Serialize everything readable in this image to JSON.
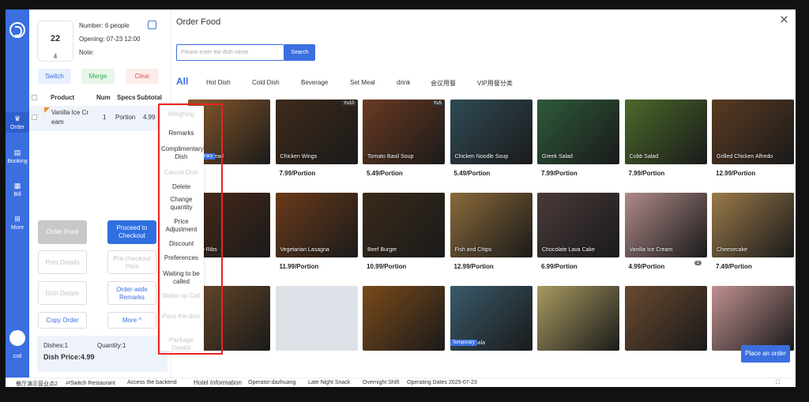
{
  "nav": {
    "items": [
      "Order",
      "Booking",
      "Bill",
      "More"
    ],
    "user": "cstl"
  },
  "table": {
    "number": "22",
    "guests": "4",
    "number_label": "Number: 6 people",
    "opening": "Opening: 07-23 12:00",
    "note": "Note:"
  },
  "actions": {
    "switch": "Switch",
    "merge": "Merge",
    "clear": "Clear"
  },
  "order_table": {
    "headers": [
      "Product",
      "Num",
      "Specs",
      "Subtotal"
    ],
    "rows": [
      {
        "name_line1": "Vanilla Ice Cr",
        "name_line2": "eam",
        "num": "1",
        "spec": "Portion",
        "subtotal": "4.99"
      }
    ]
  },
  "bottom_buttons": {
    "order_food": "Order Food",
    "proceed_1": "Proceed to",
    "proceed_2": "Checkout",
    "print_details": "Print Details",
    "precheckout_1": "Pre-checkout",
    "precheckout_2": "Print",
    "dish_details": "Dish Details",
    "orderwide_1": "Order-wide",
    "orderwide_2": "Remarks",
    "copy_order": "Copy Order",
    "more": "More ^"
  },
  "summary": {
    "dishes": "Dishes:1",
    "quantity": "Quantity:1",
    "price": "Dish Price:4.99"
  },
  "context_menu": {
    "items": [
      {
        "label": "Weighing",
        "enabled": false
      },
      {
        "label": "Remarks",
        "enabled": true
      },
      {
        "label": "Complimentary Dish",
        "enabled": true
      },
      {
        "label": "Cancel Dish",
        "enabled": false
      },
      {
        "label": "Delete",
        "enabled": true
      },
      {
        "label": "Change quantity",
        "enabled": true
      },
      {
        "label": "Price Adjustment",
        "enabled": true
      },
      {
        "label": "Discount",
        "enabled": true
      },
      {
        "label": "Preferences",
        "enabled": true
      },
      {
        "label": "Waiting to be called",
        "enabled": true
      },
      {
        "label": "Wake-up Call",
        "enabled": false
      },
      {
        "label": "Pass the dish",
        "enabled": false
      },
      {
        "label": "Package Details",
        "enabled": false
      }
    ]
  },
  "dialog": {
    "title": "Order Food",
    "close": "×",
    "search_placeholder": "Please enter the dish name",
    "search_button": "Search"
  },
  "categories": [
    "All",
    "Hot Dish",
    "Cold Dish",
    "Beverage",
    "Set Meal",
    "drink",
    "会议用餐",
    "VIP用餐分类"
  ],
  "dishes": [
    {
      "name": "Garlic Bread",
      "price": "",
      "tag": "",
      "label": "Temporary"
    },
    {
      "name": "Chicken Wings",
      "price": "7.99/Portion",
      "tag": "Yu10",
      "label": ""
    },
    {
      "name": "Tomato Basil Soup",
      "price": "5.49/Portion",
      "tag": "Yu5",
      "label": ""
    },
    {
      "name": "Chicken Noodle Soup",
      "price": "5.49/Portion",
      "tag": "",
      "label": ""
    },
    {
      "name": "Greek Salad",
      "price": "7.99/Portion",
      "tag": "",
      "label": ""
    },
    {
      "name": "Cobb Salad",
      "price": "7.99/Portion",
      "tag": "",
      "label": ""
    },
    {
      "name": "Grilled Chicken Alfredo",
      "price": "12.99/Portion",
      "tag": "",
      "label": ""
    },
    {
      "name": "BBQ Ribs",
      "price": "",
      "tag": "",
      "label": ""
    },
    {
      "name": "Vegetarian Lasagna",
      "price": "11.99/Portion",
      "tag": "",
      "label": ""
    },
    {
      "name": "Beef Burger",
      "price": "10.99/Portion",
      "tag": "",
      "label": ""
    },
    {
      "name": "Fish and Chips",
      "price": "12.99/Portion",
      "tag": "",
      "label": ""
    },
    {
      "name": "Chocolate Lava Cake",
      "price": "6.99/Portion",
      "tag": "",
      "label": ""
    },
    {
      "name": "Vanilla Ice Cream",
      "price": "4.99/Portion",
      "tag": "",
      "label": "",
      "badge": "1"
    },
    {
      "name": "Cheesecake",
      "price": "7.49/Portion",
      "tag": "",
      "label": ""
    },
    {
      "name": "",
      "price": "",
      "tag": "",
      "label": ""
    },
    {
      "name": "",
      "price": "",
      "tag": "",
      "label": ""
    },
    {
      "name": "",
      "price": "",
      "tag": "",
      "label": ""
    },
    {
      "name": "Caesar Sala",
      "price": "",
      "tag": "",
      "label": "Temporary"
    },
    {
      "name": "",
      "price": "",
      "tag": "",
      "label": ""
    },
    {
      "name": "",
      "price": "",
      "tag": "",
      "label": ""
    },
    {
      "name": "",
      "price": "",
      "tag": "",
      "label": ""
    }
  ],
  "place_order": "Place an order",
  "statusbar": [
    "餐厅演示营业点2",
    "⇄Switch Restaurant",
    "Access the backend",
    "Hotel Information",
    "Operator:dazhuang",
    "Late Night Snack",
    "Overnight Shift",
    "Operating Dates 2025-07-23"
  ]
}
